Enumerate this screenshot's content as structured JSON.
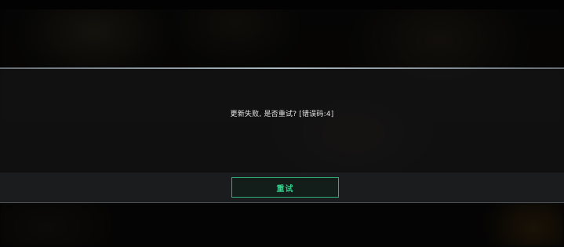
{
  "dialog": {
    "message": "更新失败, 是否重试? [错误码:4]",
    "retry_label": "重试"
  },
  "colors": {
    "accent": "#33d08c",
    "button_border": "#2fae7a",
    "text": "#e6e6e6"
  }
}
